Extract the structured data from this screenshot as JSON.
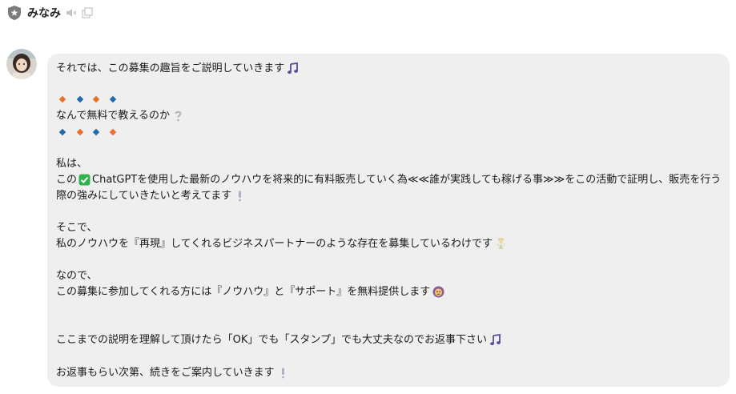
{
  "header": {
    "name": "みなみ",
    "icons": [
      "shield-star-icon",
      "speaker-muted-icon",
      "external-window-icon"
    ]
  },
  "message": {
    "lines": [
      "それでは、この募集の趣旨をご説明していきます",
      "なんで無料で教えるのか",
      "私は、",
      "この",
      "ChatGPTを使用した最新のノウハウを将来的に有料販売していく為≪≪誰が実践しても稼げる事≫≫をこの活動で証明し、販売を行う",
      "際の強みにしていきたいと考えてます",
      "そこで、",
      "私のノウハウを『再現』してくれるビジネスパートナーのような存在を募集しているわけです",
      "なので、",
      "この募集に参加してくれる方には『ノウハウ』と『サポート』を無料提供します",
      "ここまでの説明を理解して頂けたら「OK」でも「スタンプ」でも大丈夫なのでお返事下さい",
      "お返事もらい次第、続きをご案内していきます"
    ]
  },
  "colors": {
    "bubble": "#efefef",
    "diamond_orange": "#e8702a",
    "diamond_blue": "#1e6bb0",
    "music_note": "#5a4a9a",
    "check_green": "#2fb24c"
  }
}
